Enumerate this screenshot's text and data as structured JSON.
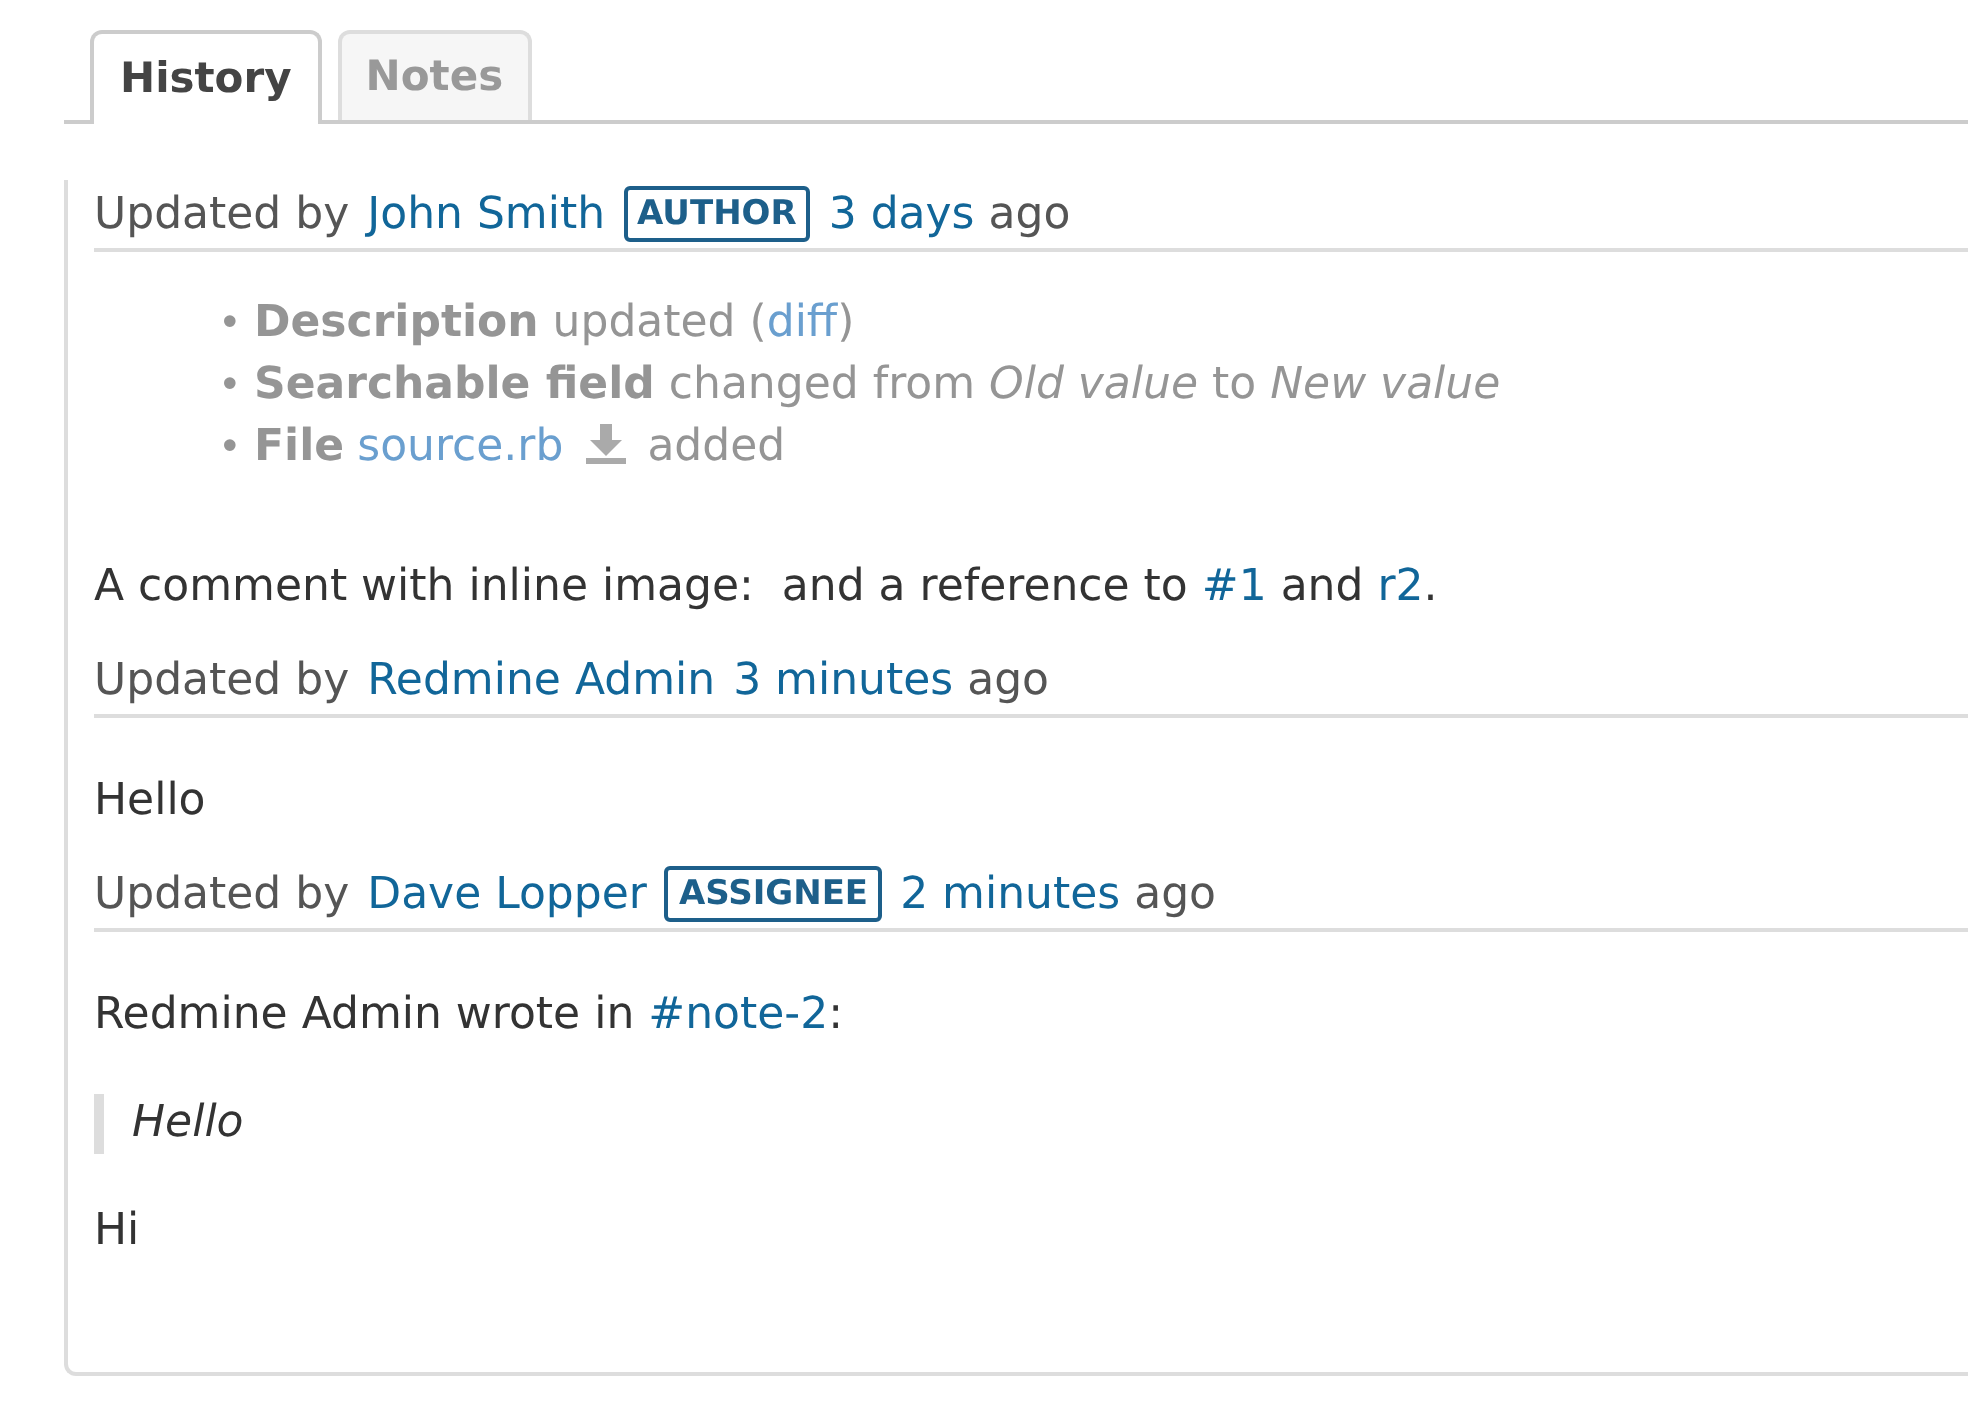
{
  "tabs": [
    {
      "label": "History",
      "selected": true
    },
    {
      "label": "Notes",
      "selected": false
    }
  ],
  "journals": [
    {
      "prefix": "Updated by",
      "user": "John Smith",
      "badge": "AUTHOR",
      "time": "3 days",
      "suffix": "ago",
      "details": [
        {
          "marker": "•",
          "segments": [
            {
              "kind": "bold",
              "text": "Description"
            },
            {
              "kind": "text",
              "text": " updated ("
            },
            {
              "kind": "link",
              "text": "diff"
            },
            {
              "kind": "text",
              "text": ")"
            }
          ]
        },
        {
          "marker": "•",
          "segments": [
            {
              "kind": "bold",
              "text": "Searchable field"
            },
            {
              "kind": "text",
              "text": " changed from "
            },
            {
              "kind": "italic",
              "text": "Old value"
            },
            {
              "kind": "text",
              "text": " to "
            },
            {
              "kind": "italic",
              "text": "New value"
            }
          ]
        },
        {
          "marker": "•",
          "segments": [
            {
              "kind": "bold",
              "text": "File"
            },
            {
              "kind": "file",
              "text": "source.rb"
            },
            {
              "kind": "text",
              "text": "added"
            }
          ]
        }
      ],
      "blocks": [
        {
          "kind": "paragraph",
          "segments": [
            {
              "kind": "text",
              "text": "A comment with inline image:  and a reference to "
            },
            {
              "kind": "link",
              "text": "#1"
            },
            {
              "kind": "text",
              "text": " and "
            },
            {
              "kind": "link",
              "text": "r2"
            },
            {
              "kind": "text",
              "text": "."
            }
          ]
        }
      ]
    },
    {
      "prefix": "Updated by",
      "user": "Redmine Admin",
      "time": "3 minutes",
      "suffix": "ago",
      "blocks": [
        {
          "kind": "paragraph",
          "segments": [
            {
              "kind": "text",
              "text": "Hello"
            }
          ]
        }
      ]
    },
    {
      "prefix": "Updated by",
      "user": "Dave Lopper",
      "badge": "ASSIGNEE",
      "time": "2 minutes",
      "suffix": "ago",
      "blocks": [
        {
          "kind": "paragraph",
          "segments": [
            {
              "kind": "text",
              "text": "Redmine Admin wrote in "
            },
            {
              "kind": "link",
              "text": "#note-2"
            },
            {
              "kind": "text",
              "text": ":"
            }
          ]
        },
        {
          "kind": "quote",
          "segments": [
            {
              "kind": "text",
              "text": "Hello"
            }
          ]
        },
        {
          "kind": "paragraph",
          "segments": [
            {
              "kind": "text",
              "text": "Hi"
            }
          ]
        }
      ]
    }
  ]
}
